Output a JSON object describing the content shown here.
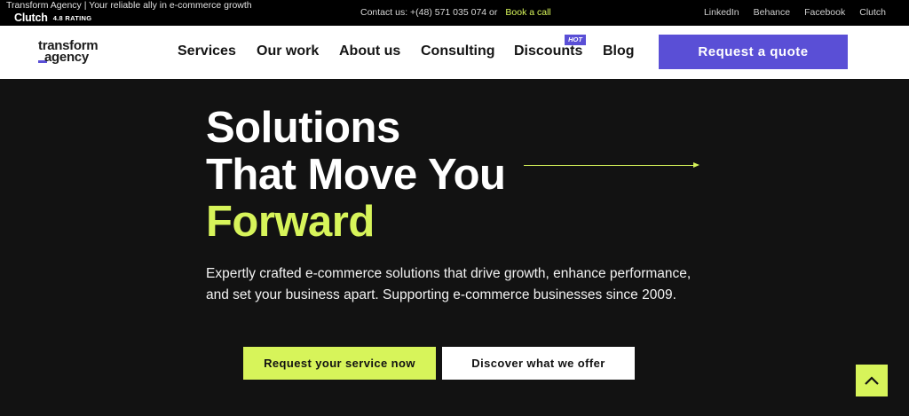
{
  "topbar": {
    "tagline": "Transform Agency | Your reliable ally in e-commerce growth",
    "clutch_logo": "Clutch",
    "clutch_rating": "4.8 RATING",
    "contact_text": "Contact us: +(48) 571 035 074 or",
    "book_call": "Book a call",
    "social": [
      "LinkedIn",
      "Behance",
      "Facebook",
      "Clutch"
    ]
  },
  "nav": {
    "logo_line1": "transform",
    "logo_line2": "agency",
    "items": [
      "Services",
      "Our work",
      "About us",
      "Consulting",
      "Discounts",
      "Blog"
    ],
    "hot_badge": "HOT",
    "quote_button": "Request a quote"
  },
  "hero": {
    "title_line1": "Solutions",
    "title_line2": "That Move You",
    "title_line3": "Forward",
    "description": "Expertly crafted e-commerce solutions that drive growth, enhance performance, and set your business apart. Supporting e-commerce businesses since 2009.",
    "primary_button": "Request your service now",
    "secondary_button": "Discover what we offer"
  },
  "colors": {
    "accent_lime": "#d7f45a",
    "accent_purple": "#5a4fd6",
    "background": "#121212"
  },
  "icons": {
    "scroll_top": "chevron-up-icon"
  }
}
